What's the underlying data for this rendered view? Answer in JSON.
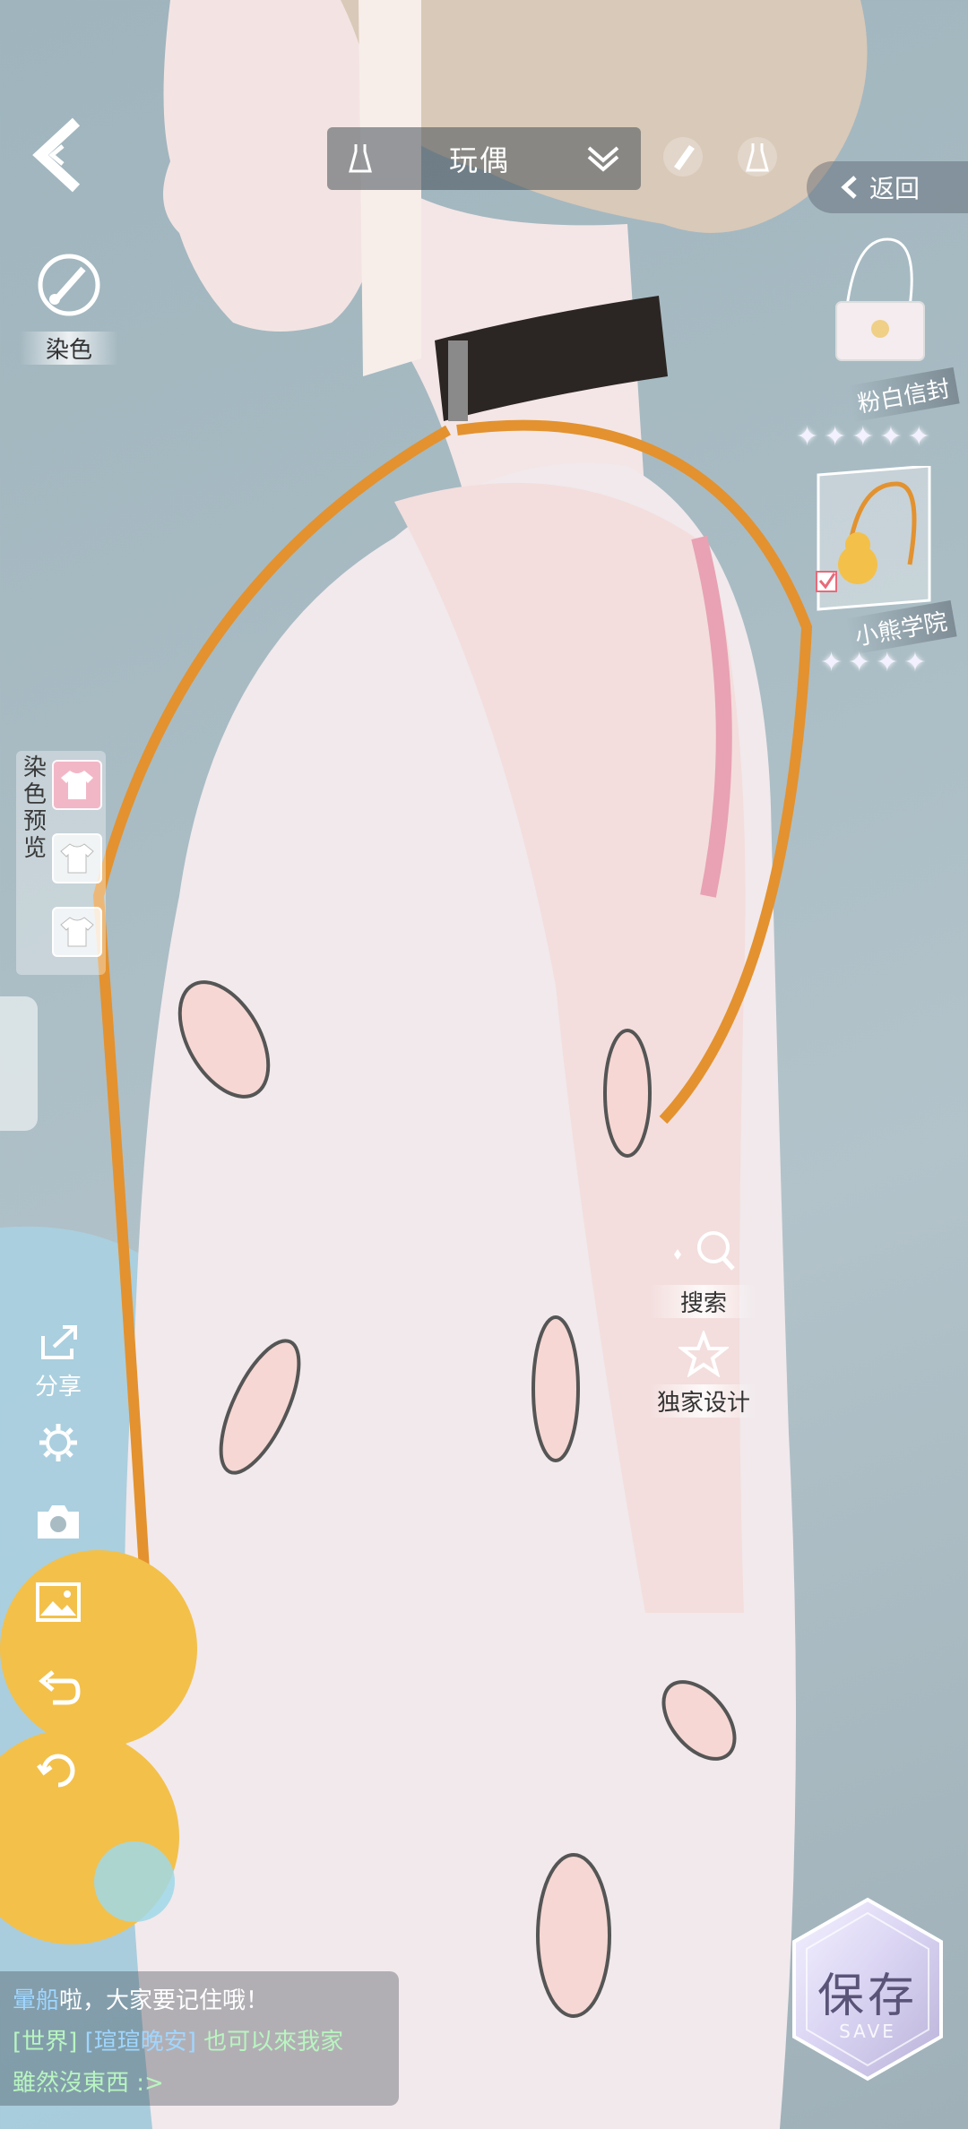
{
  "top_bar": {
    "category_label": "玩偶",
    "back_label": "返回"
  },
  "left_tools": {
    "dye_label": "染色",
    "dye_preview_label": "染色预览",
    "share_label": "分享"
  },
  "items": [
    {
      "name": "粉白信封",
      "stars": 5
    },
    {
      "name": "小熊学院",
      "stars": 4
    }
  ],
  "actions": {
    "search_label": "搜索",
    "exclusive_label": "独家设计"
  },
  "chat": {
    "line1_name": "暈船",
    "line1_text": "啦，大家要记住哦！",
    "line2_channel": "[世界]",
    "line2_name": "[瑄瑄晚安]",
    "line2_text": "也可以來我家",
    "line3_text": "雖然沒東西 :>"
  },
  "save": {
    "label": "保存",
    "sub": "SAVE"
  },
  "colors": {
    "dye_swatch_1": "#f2b7c7",
    "dye_swatch_2": "#ffffff",
    "dye_swatch_3": "#ffffff"
  }
}
